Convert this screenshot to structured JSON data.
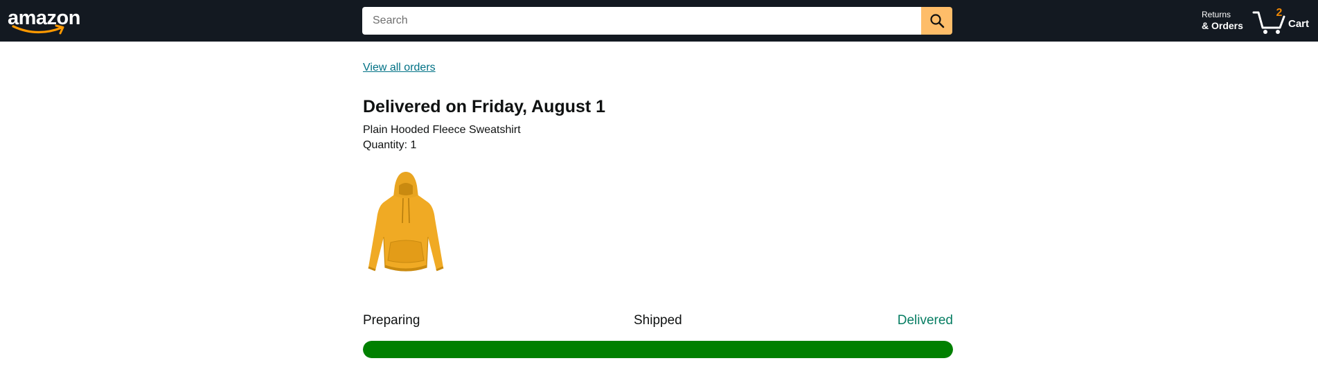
{
  "header": {
    "logo_text": "amazon",
    "background_color": "#131921",
    "search": {
      "placeholder": "Search",
      "value": "",
      "button_icon": "search-icon",
      "button_color": "#febd69"
    },
    "returns": {
      "line1": "Returns",
      "line2": "& Orders"
    },
    "cart": {
      "count": "2",
      "label": "Cart",
      "icon": "cart-icon"
    }
  },
  "order": {
    "view_all_link": "View all orders",
    "status_title": "Delivered on Friday, August 1",
    "product_name": "Plain Hooded Fleece Sweatshirt",
    "quantity_text": "Quantity: 1",
    "product_image": "yellow-hoodie-image"
  },
  "progress": {
    "steps": [
      "Preparing",
      "Shipped",
      "Delivered"
    ],
    "current_step": "Delivered",
    "fraction_complete": 1.0,
    "bar_color": "#008000",
    "active_label_color": "#067d62"
  }
}
